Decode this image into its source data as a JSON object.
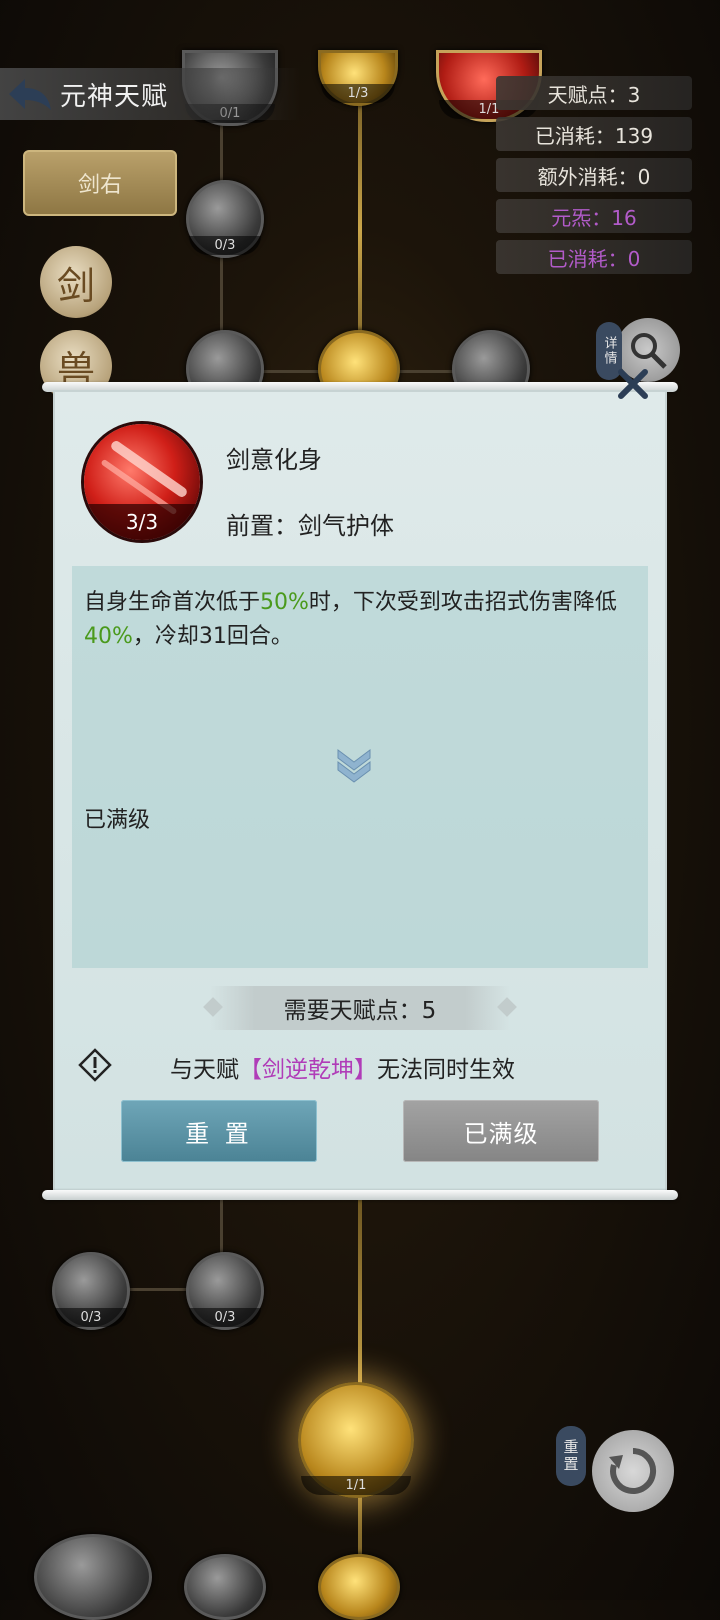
{
  "header": {
    "title": "元神天赋"
  },
  "stats": {
    "talent_points": "天赋点：3",
    "consumed": "已消耗：139",
    "extra_cost": "额外消耗：0",
    "yuansha": "元炁：16",
    "consumed2": "已消耗：0"
  },
  "side": {
    "tab_label": "剑右",
    "circle1": "剑",
    "circle2": "兽",
    "detail_label": "详情",
    "reset_label": "重置"
  },
  "tree_nodes": {
    "n1": "0/1",
    "n2": "1/3",
    "n3": "1/1",
    "n4": "0/3",
    "n5": "0/3",
    "n6": "0/3",
    "n7": "1/1"
  },
  "modal": {
    "skill_level": "3/3",
    "skill_name": "剑意化身",
    "prerequisite": "前置：剑气护体",
    "desc_part1": "自身生命首次低于",
    "desc_pct1": "50%",
    "desc_part2": "时，下次受到攻击招式伤害降低",
    "desc_pct2": "40%",
    "desc_part3": "，冷却31回合。",
    "maxed_status": "已满级",
    "required_points": "需要天赋点：5",
    "conflict_prefix": "与天赋",
    "conflict_talent": "【剑逆乾坤】",
    "conflict_suffix": "无法同时生效",
    "reset_button": "重 置",
    "maxed_button": "已满级"
  },
  "colors": {
    "highlight_green": "#4a9a1c",
    "talent_purple": "#b03cb8",
    "reset_btn": "#5a93a5"
  }
}
